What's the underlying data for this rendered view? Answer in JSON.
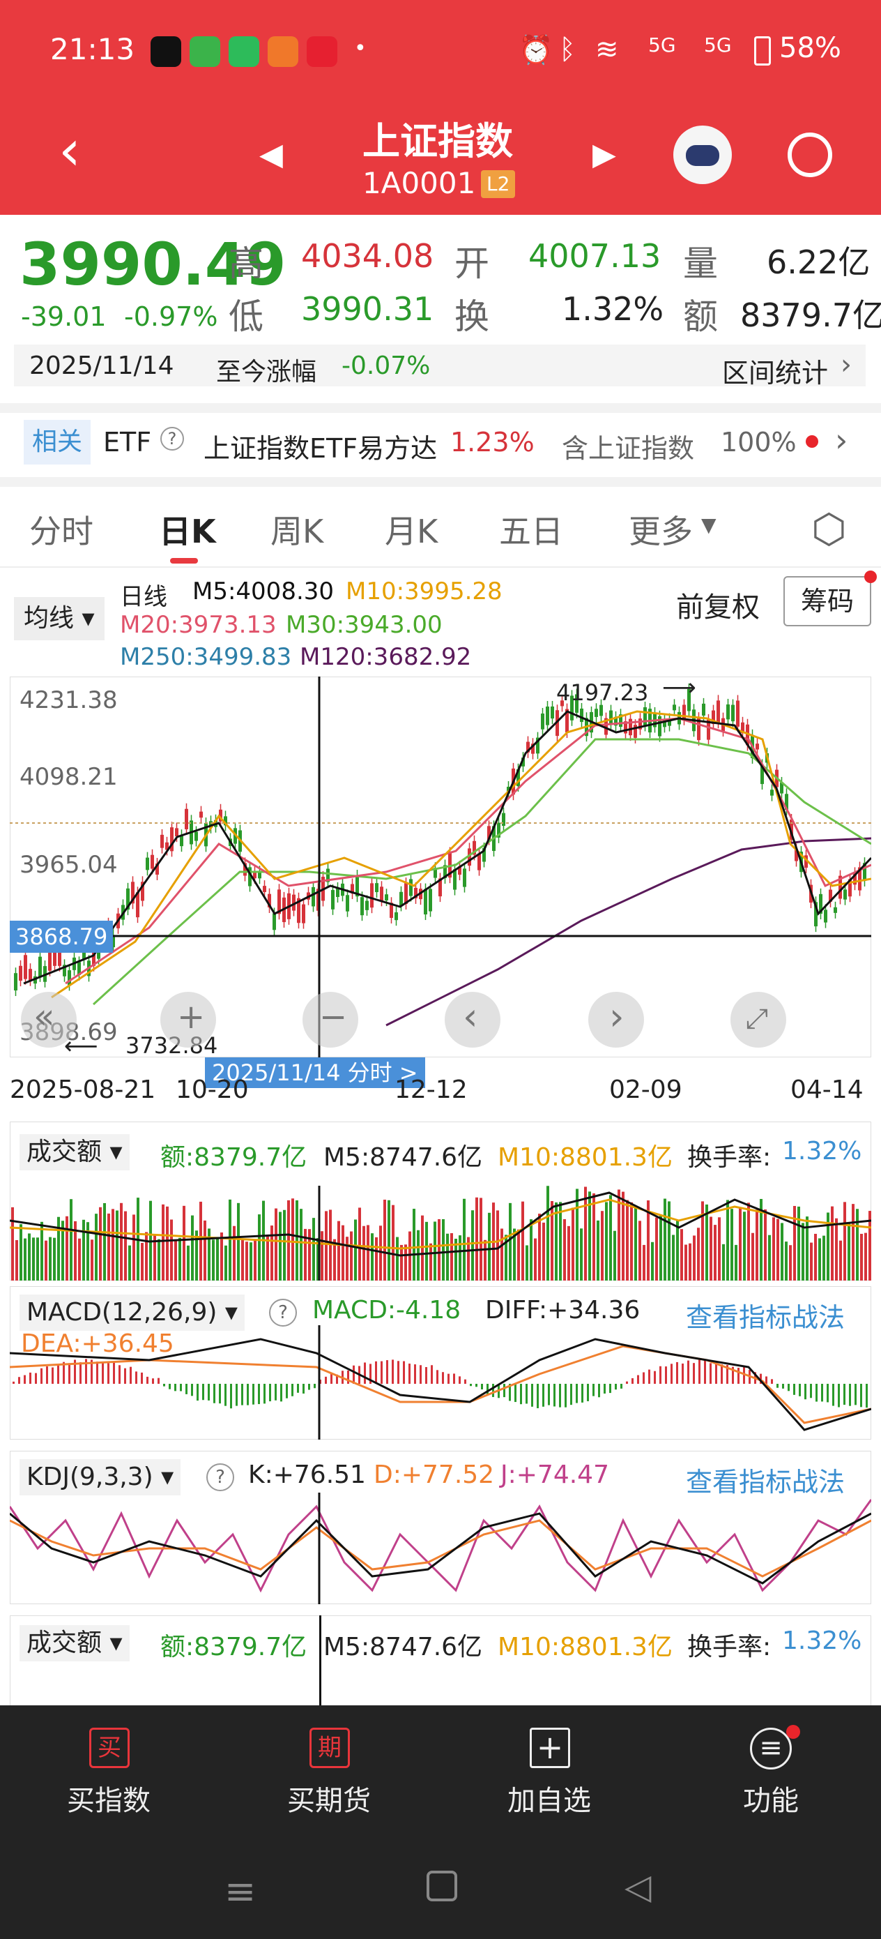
{
  "status": {
    "time": "21:13",
    "net1": "5G",
    "net2": "5G",
    "battery": "58%"
  },
  "header": {
    "title": "上证指数",
    "code": "1A0001",
    "level": "L2"
  },
  "quote": {
    "price": "3990.49",
    "change": "-39.01",
    "pct": "-0.97%",
    "high_label": "高",
    "high": "4034.08",
    "open_label": "开",
    "open": "4007.13",
    "vol_label": "量",
    "vol": "6.22亿",
    "low_label": "低",
    "low": "3990.31",
    "turn_label": "换",
    "turn": "1.32%",
    "amt_label": "额",
    "amt": "8379.7亿",
    "date": "2025/11/14",
    "since_label": "至今涨幅",
    "since": "-0.07%",
    "range_stats": "区间统计"
  },
  "related": {
    "tag": "相关",
    "etf": "ETF",
    "etf_name": "上证指数ETF易方达",
    "etf_pct": "1.23%",
    "hold_label": "含上证指数",
    "hold_pct": "100%"
  },
  "tabs": [
    "分时",
    "日K",
    "周K",
    "月K",
    "五日",
    "更多"
  ],
  "ma": {
    "ma_btn": "均线",
    "period": "日线",
    "m5": "M5:4008.30",
    "m10": "M10:3995.28",
    "m20": "M20:3973.13",
    "m30": "M30:3943.00",
    "m250": "M250:3499.83",
    "m120": "M120:3682.92",
    "adjust": "前复权",
    "chips": "筹码"
  },
  "chart": {
    "y_ticks": [
      "4231.38",
      "4098.21",
      "3965.04",
      "3868.79"
    ],
    "max_label": "4197.23",
    "min_label": "3732.84",
    "min_tick": "3898.69",
    "x_labels": [
      "2025-08-21",
      "10-20",
      "12-12",
      "02-09",
      "04-14"
    ],
    "cursor_label": "2025/11/14  分时  >"
  },
  "vol_panel": {
    "title": "成交额",
    "amt": "额:8379.7亿",
    "m5": "M5:8747.6亿",
    "m10": "M10:8801.3亿",
    "turn": "换手率:",
    "turn_val": "1.32%"
  },
  "macd": {
    "title": "MACD(12,26,9)",
    "macd": "MACD:-4.18",
    "diff": "DIFF:+34.36",
    "dea": "DEA:+36.45",
    "link": "查看指标战法"
  },
  "kdj": {
    "title": "KDJ(9,3,3)",
    "k": "K:+76.51",
    "d": "D:+77.52",
    "j": "J:+74.47",
    "link": "查看指标战法"
  },
  "bottom": [
    {
      "icon": "买",
      "label": "买指数"
    },
    {
      "icon": "期",
      "label": "买期货"
    },
    {
      "icon": "+",
      "label": "加自选"
    },
    {
      "icon": "≡",
      "label": "功能"
    }
  ],
  "colors": {
    "header": "#e83a3f",
    "up": "#d6333a",
    "down": "#2a9a2a",
    "ma5": "#111111",
    "ma10": "#e6a000",
    "ma20": "#e0526a",
    "ma30": "#6cc04a",
    "ma120": "#5a1a5a"
  }
}
